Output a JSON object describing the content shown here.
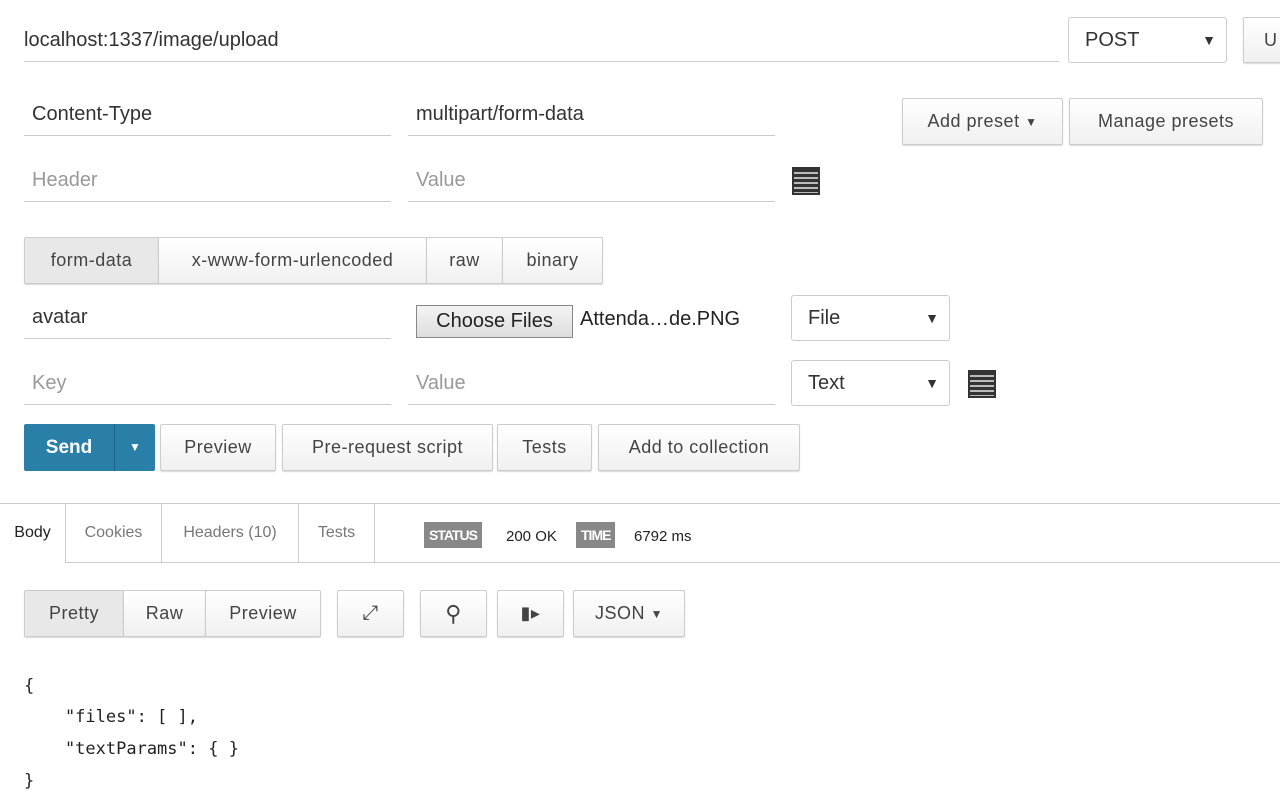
{
  "request": {
    "url": "localhost:1337/image/upload",
    "method": "POST",
    "url_params_label": "U"
  },
  "headers": {
    "rows": [
      {
        "key": "Content-Type",
        "value": "multipart/form-data"
      }
    ],
    "key_placeholder": "Header",
    "value_placeholder": "Value",
    "add_preset": "Add preset",
    "manage_presets": "Manage presets"
  },
  "body_tabs": [
    "form-data",
    "x-www-form-urlencoded",
    "raw",
    "binary"
  ],
  "form": {
    "rows": [
      {
        "key": "avatar",
        "choose_label": "Choose Files",
        "file_name": "Attenda…de.PNG",
        "type": "File"
      }
    ],
    "key_placeholder": "Key",
    "value_placeholder": "Value",
    "new_type": "Text"
  },
  "actions": {
    "send": "Send",
    "preview": "Preview",
    "prerequest": "Pre-request script",
    "tests": "Tests",
    "add_collection": "Add to collection"
  },
  "response": {
    "tabs": [
      "Body",
      "Cookies",
      "Headers (10)",
      "Tests"
    ],
    "status_label": "STATUS",
    "status": "200 OK",
    "time_label": "TIME",
    "time": "6792 ms",
    "view_modes": [
      "Pretty",
      "Raw",
      "Preview"
    ],
    "format": "JSON",
    "body_lines": [
      "{",
      "    \"files\": [ ],",
      "    \"textParams\": { }",
      "}"
    ]
  },
  "colors": {
    "send": "#2a7fa8"
  }
}
